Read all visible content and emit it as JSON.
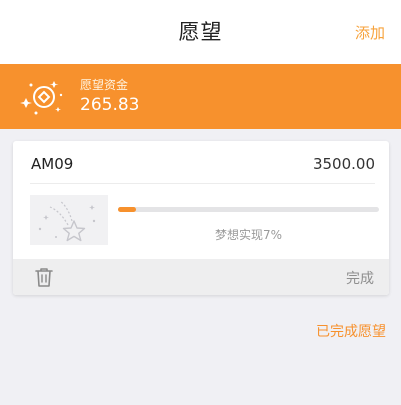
{
  "header": {
    "title": "愿望",
    "add_label": "添加"
  },
  "fund": {
    "label": "愿望资金",
    "amount": "265.83",
    "icon": "coin-sparkle-icon"
  },
  "wish": {
    "name": "AM09",
    "price": "3500.00",
    "progress": 0.07,
    "progress_text": "梦想实现7%",
    "image_icon": "shooting-star-icon",
    "delete_icon": "trash-icon",
    "complete_label": "完成"
  },
  "footer": {
    "completed_link": "已完成愿望"
  },
  "colors": {
    "accent": "#f7912d",
    "banner": "#f7912d",
    "background": "#f0f0f4"
  }
}
